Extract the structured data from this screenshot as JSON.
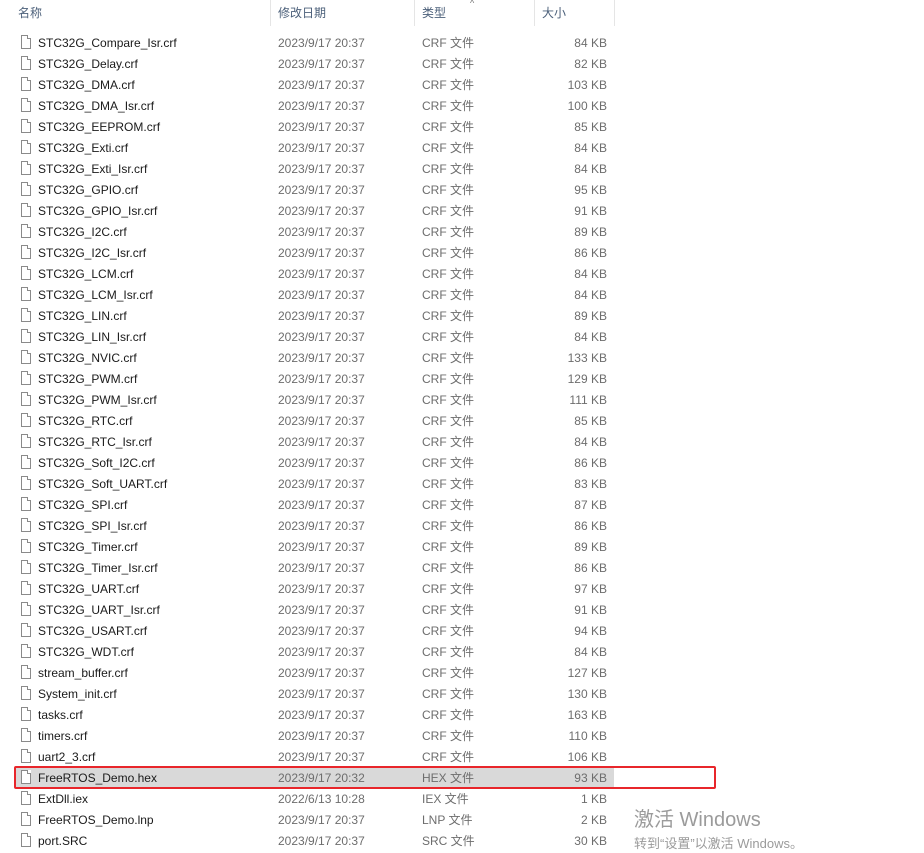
{
  "columns": {
    "name": "名称",
    "date": "修改日期",
    "type": "类型",
    "size": "大小"
  },
  "files": [
    {
      "name": "STC32G_Compare_Isr.crf",
      "date": "2023/9/17 20:37",
      "type": "CRF 文件",
      "size": "84 KB"
    },
    {
      "name": "STC32G_Delay.crf",
      "date": "2023/9/17 20:37",
      "type": "CRF 文件",
      "size": "82 KB"
    },
    {
      "name": "STC32G_DMA.crf",
      "date": "2023/9/17 20:37",
      "type": "CRF 文件",
      "size": "103 KB"
    },
    {
      "name": "STC32G_DMA_Isr.crf",
      "date": "2023/9/17 20:37",
      "type": "CRF 文件",
      "size": "100 KB"
    },
    {
      "name": "STC32G_EEPROM.crf",
      "date": "2023/9/17 20:37",
      "type": "CRF 文件",
      "size": "85 KB"
    },
    {
      "name": "STC32G_Exti.crf",
      "date": "2023/9/17 20:37",
      "type": "CRF 文件",
      "size": "84 KB"
    },
    {
      "name": "STC32G_Exti_Isr.crf",
      "date": "2023/9/17 20:37",
      "type": "CRF 文件",
      "size": "84 KB"
    },
    {
      "name": "STC32G_GPIO.crf",
      "date": "2023/9/17 20:37",
      "type": "CRF 文件",
      "size": "95 KB"
    },
    {
      "name": "STC32G_GPIO_Isr.crf",
      "date": "2023/9/17 20:37",
      "type": "CRF 文件",
      "size": "91 KB"
    },
    {
      "name": "STC32G_I2C.crf",
      "date": "2023/9/17 20:37",
      "type": "CRF 文件",
      "size": "89 KB"
    },
    {
      "name": "STC32G_I2C_Isr.crf",
      "date": "2023/9/17 20:37",
      "type": "CRF 文件",
      "size": "86 KB"
    },
    {
      "name": "STC32G_LCM.crf",
      "date": "2023/9/17 20:37",
      "type": "CRF 文件",
      "size": "84 KB"
    },
    {
      "name": "STC32G_LCM_Isr.crf",
      "date": "2023/9/17 20:37",
      "type": "CRF 文件",
      "size": "84 KB"
    },
    {
      "name": "STC32G_LIN.crf",
      "date": "2023/9/17 20:37",
      "type": "CRF 文件",
      "size": "89 KB"
    },
    {
      "name": "STC32G_LIN_Isr.crf",
      "date": "2023/9/17 20:37",
      "type": "CRF 文件",
      "size": "84 KB"
    },
    {
      "name": "STC32G_NVIC.crf",
      "date": "2023/9/17 20:37",
      "type": "CRF 文件",
      "size": "133 KB"
    },
    {
      "name": "STC32G_PWM.crf",
      "date": "2023/9/17 20:37",
      "type": "CRF 文件",
      "size": "129 KB"
    },
    {
      "name": "STC32G_PWM_Isr.crf",
      "date": "2023/9/17 20:37",
      "type": "CRF 文件",
      "size": "111 KB"
    },
    {
      "name": "STC32G_RTC.crf",
      "date": "2023/9/17 20:37",
      "type": "CRF 文件",
      "size": "85 KB"
    },
    {
      "name": "STC32G_RTC_Isr.crf",
      "date": "2023/9/17 20:37",
      "type": "CRF 文件",
      "size": "84 KB"
    },
    {
      "name": "STC32G_Soft_I2C.crf",
      "date": "2023/9/17 20:37",
      "type": "CRF 文件",
      "size": "86 KB"
    },
    {
      "name": "STC32G_Soft_UART.crf",
      "date": "2023/9/17 20:37",
      "type": "CRF 文件",
      "size": "83 KB"
    },
    {
      "name": "STC32G_SPI.crf",
      "date": "2023/9/17 20:37",
      "type": "CRF 文件",
      "size": "87 KB"
    },
    {
      "name": "STC32G_SPI_Isr.crf",
      "date": "2023/9/17 20:37",
      "type": "CRF 文件",
      "size": "86 KB"
    },
    {
      "name": "STC32G_Timer.crf",
      "date": "2023/9/17 20:37",
      "type": "CRF 文件",
      "size": "89 KB"
    },
    {
      "name": "STC32G_Timer_Isr.crf",
      "date": "2023/9/17 20:37",
      "type": "CRF 文件",
      "size": "86 KB"
    },
    {
      "name": "STC32G_UART.crf",
      "date": "2023/9/17 20:37",
      "type": "CRF 文件",
      "size": "97 KB"
    },
    {
      "name": "STC32G_UART_Isr.crf",
      "date": "2023/9/17 20:37",
      "type": "CRF 文件",
      "size": "91 KB"
    },
    {
      "name": "STC32G_USART.crf",
      "date": "2023/9/17 20:37",
      "type": "CRF 文件",
      "size": "94 KB"
    },
    {
      "name": "STC32G_WDT.crf",
      "date": "2023/9/17 20:37",
      "type": "CRF 文件",
      "size": "84 KB"
    },
    {
      "name": "stream_buffer.crf",
      "date": "2023/9/17 20:37",
      "type": "CRF 文件",
      "size": "127 KB"
    },
    {
      "name": "System_init.crf",
      "date": "2023/9/17 20:37",
      "type": "CRF 文件",
      "size": "130 KB"
    },
    {
      "name": "tasks.crf",
      "date": "2023/9/17 20:37",
      "type": "CRF 文件",
      "size": "163 KB"
    },
    {
      "name": "timers.crf",
      "date": "2023/9/17 20:37",
      "type": "CRF 文件",
      "size": "110 KB"
    },
    {
      "name": "uart2_3.crf",
      "date": "2023/9/17 20:37",
      "type": "CRF 文件",
      "size": "106 KB"
    },
    {
      "name": "FreeRTOS_Demo.hex",
      "date": "2023/9/17 20:32",
      "type": "HEX 文件",
      "size": "93 KB",
      "selected": true
    },
    {
      "name": "ExtDll.iex",
      "date": "2022/6/13 10:28",
      "type": "IEX 文件",
      "size": "1 KB"
    },
    {
      "name": "FreeRTOS_Demo.lnp",
      "date": "2023/9/17 20:37",
      "type": "LNP 文件",
      "size": "2 KB"
    },
    {
      "name": "port.SRC",
      "date": "2023/9/17 20:37",
      "type": "SRC 文件",
      "size": "30 KB"
    }
  ],
  "watermark": {
    "title": "激活 Windows",
    "subtitle": "转到“设置”以激活 Windows。"
  },
  "colors": {
    "highlight_border": "#e8262b",
    "selection_bg": "#d9d9d9"
  }
}
